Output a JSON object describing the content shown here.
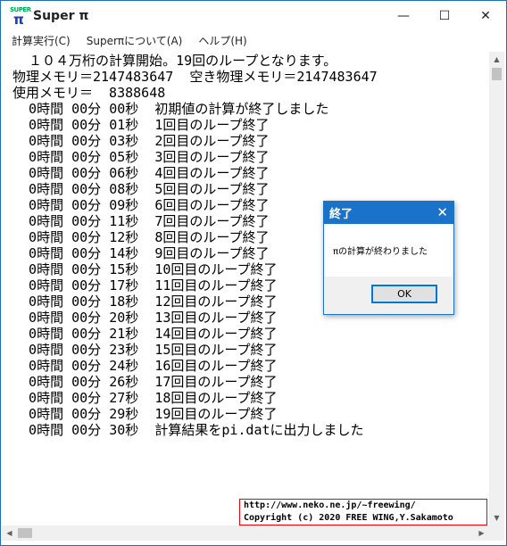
{
  "window": {
    "title": "Super π",
    "icon_text_top": "SUPER",
    "icon_text_main": "π",
    "minimize": "—",
    "maximize": "☐",
    "close": "✕"
  },
  "menu": [
    {
      "label": "計算実行(C)"
    },
    {
      "label": "Superπについて(A)"
    },
    {
      "label": "ヘルプ(H)"
    }
  ],
  "log_lines": [
    "  １０４万桁の計算開始。19回のループとなります。",
    "物理メモリ＝2147483647  空き物理メモリ＝2147483647",
    "使用メモリ＝  8388648",
    "  0時間 00分 00秒  初期値の計算が終了しました",
    "  0時間 00分 01秒  1回目のループ終了",
    "  0時間 00分 03秒  2回目のループ終了",
    "  0時間 00分 05秒  3回目のループ終了",
    "  0時間 00分 06秒  4回目のループ終了",
    "  0時間 00分 08秒  5回目のループ終了",
    "  0時間 00分 09秒  6回目のループ終了",
    "  0時間 00分 11秒  7回目のループ終了",
    "  0時間 00分 12秒  8回目のループ終了",
    "  0時間 00分 14秒  9回目のループ終了",
    "  0時間 00分 15秒  10回目のループ終了",
    "  0時間 00分 17秒  11回目のループ終了",
    "  0時間 00分 18秒  12回目のループ終了",
    "  0時間 00分 20秒  13回目のループ終了",
    "  0時間 00分 21秒  14回目のループ終了",
    "  0時間 00分 23秒  15回目のループ終了",
    "  0時間 00分 24秒  16回目のループ終了",
    "  0時間 00分 26秒  17回目のループ終了",
    "  0時間 00分 27秒  18回目のループ終了",
    "  0時間 00分 29秒  19回目のループ終了",
    "  0時間 00分 30秒  計算結果をpi.datに出力しました"
  ],
  "copyright": {
    "url": "http://www.neko.ne.jp/~freewing/",
    "text": "Copyright (c) 2020 FREE WING,Y.Sakamoto"
  },
  "dialog": {
    "title": "終了",
    "message": "πの計算が終わりました",
    "ok_label": "OK",
    "close": "✕"
  },
  "scrollbars": {
    "up": "▲",
    "down": "▼",
    "left": "◀",
    "right": "▶"
  },
  "colors": {
    "accent": "#1a73c8",
    "copyright_border": "#ee0000"
  }
}
